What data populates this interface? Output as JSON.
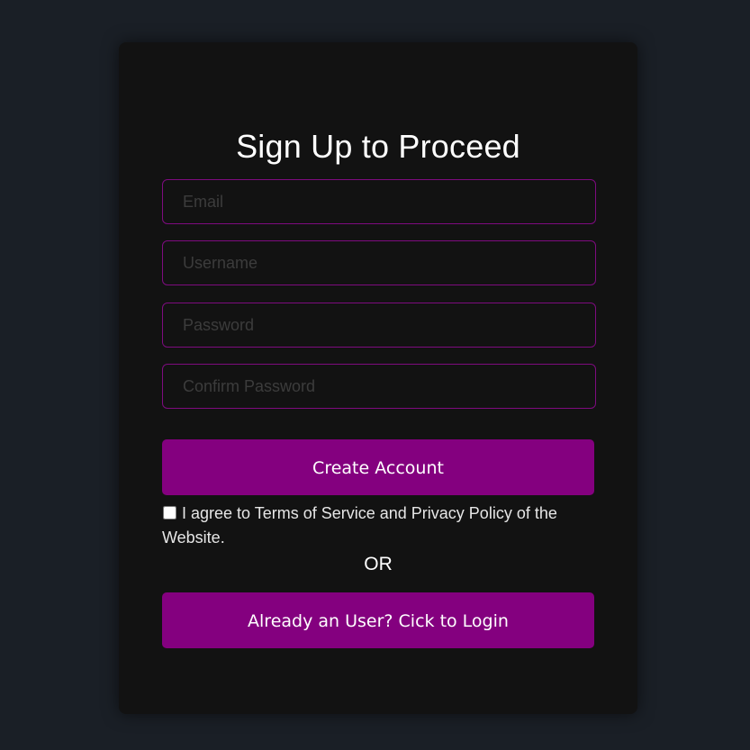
{
  "form": {
    "title": "Sign Up to Proceed",
    "fields": {
      "email": {
        "placeholder": "Email",
        "value": ""
      },
      "username": {
        "placeholder": "Username",
        "value": ""
      },
      "password": {
        "placeholder": "Password",
        "value": ""
      },
      "confirm_password": {
        "placeholder": "Confirm Password",
        "value": ""
      }
    },
    "create_account_label": "Create Account",
    "agree_text": "I agree to Terms of Service and Privacy Policy of the Website.",
    "or_label": "OR",
    "login_label": "Already an User? Cick to Login"
  },
  "colors": {
    "page_background": "#1a1f26",
    "card_background": "#121212",
    "accent": "#84007f",
    "field_border": "#7e0b7f",
    "text": "#ffffff"
  }
}
